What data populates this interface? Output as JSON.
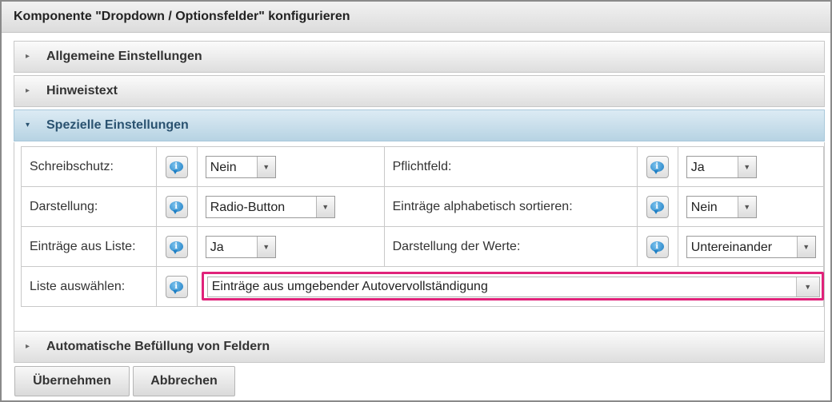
{
  "dialog": {
    "title": "Komponente \"Dropdown / Optionsfelder\" konfigurieren"
  },
  "sections": {
    "general": {
      "label": "Allgemeine Einstellungen",
      "arrow": "▸"
    },
    "hint": {
      "label": "Hinweistext",
      "arrow": "▸"
    },
    "special": {
      "label": "Spezielle Einstellungen",
      "arrow": "▾"
    },
    "autofill": {
      "label": "Automatische Befüllung von Feldern",
      "arrow": "▸"
    }
  },
  "fields": {
    "readonly": {
      "label": "Schreibschutz:",
      "value": "Nein"
    },
    "required": {
      "label": "Pflichtfeld:",
      "value": "Ja"
    },
    "display": {
      "label": "Darstellung:",
      "value": "Radio-Button"
    },
    "sort": {
      "label": "Einträge alphabetisch sortieren:",
      "value": "Nein"
    },
    "fromlist": {
      "label": "Einträge aus Liste:",
      "value": "Ja"
    },
    "valuesdisplay": {
      "label": "Darstellung der Werte:",
      "value": "Untereinander"
    },
    "selectlist": {
      "label": "Liste auswählen:",
      "value": "Einträge aus umgebender Autovervollständigung"
    }
  },
  "icons": {
    "info": "info-bubble-icon",
    "dropdown": "chevron-down-icon",
    "info_glyph": "i",
    "dropdown_glyph": "▼"
  },
  "buttons": {
    "apply": "Übernehmen",
    "cancel": "Abbrechen"
  },
  "colors": {
    "highlight": "#e0227a",
    "section_open": "#b7d3e3"
  }
}
